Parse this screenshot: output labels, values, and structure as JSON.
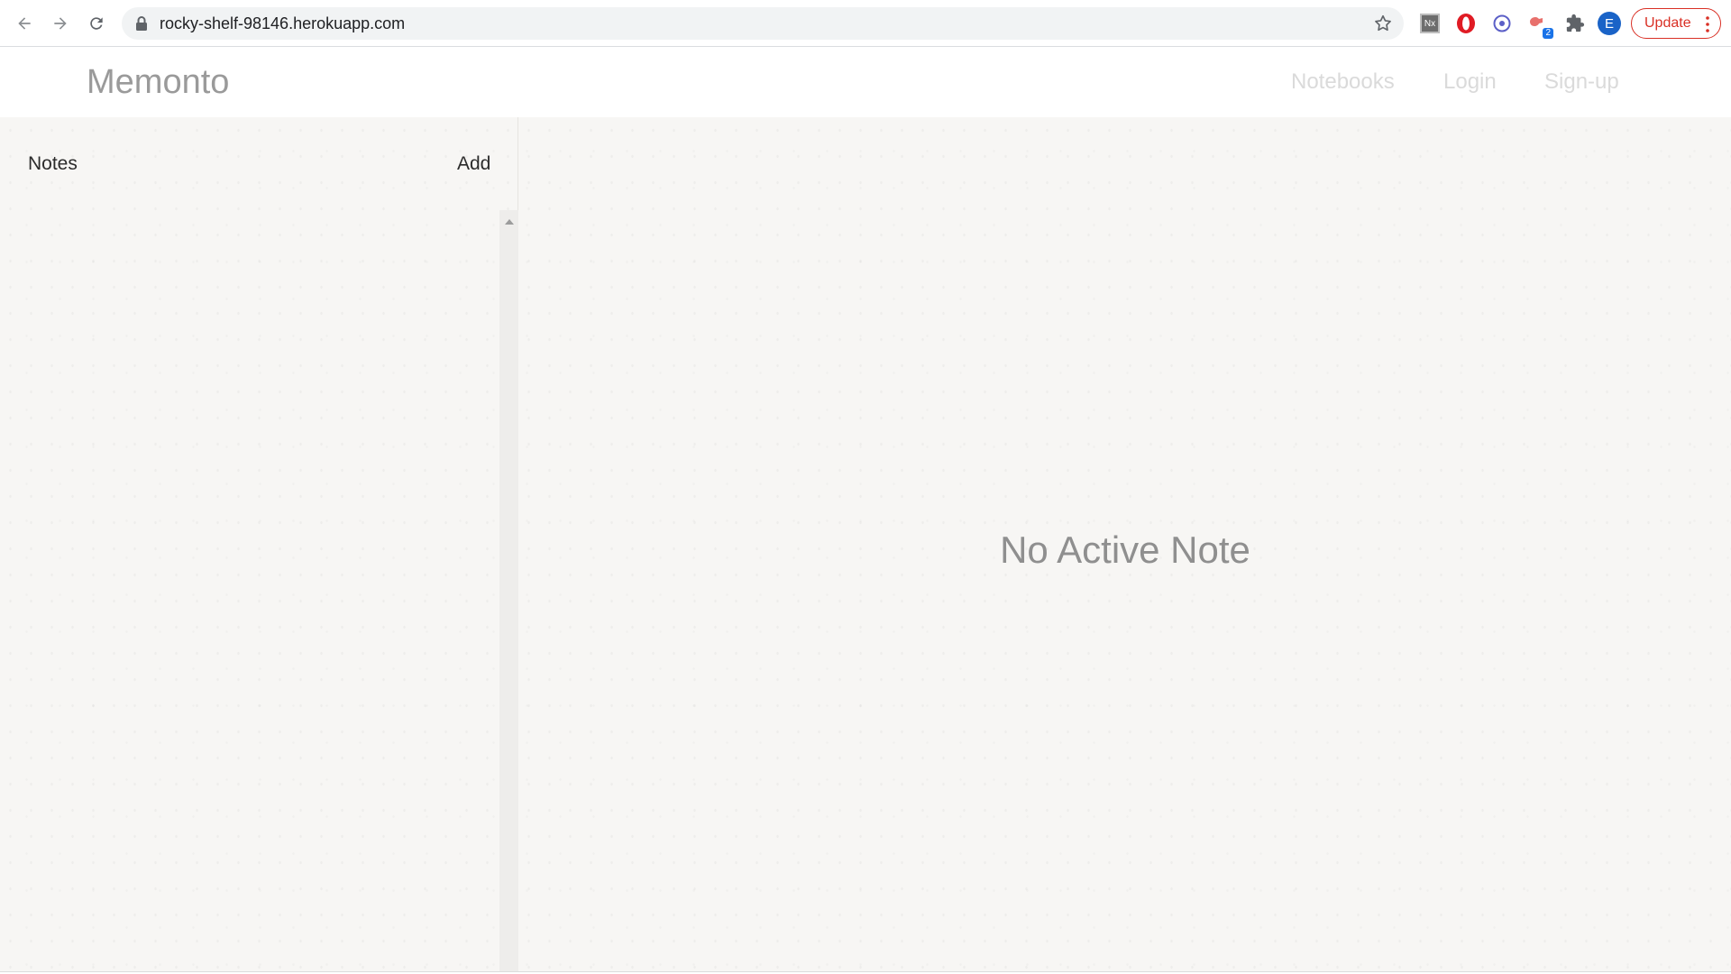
{
  "browser": {
    "url": "rocky-shelf-98146.herokuapp.com",
    "avatar_letter": "E",
    "translate_badge": "2",
    "nx_label": "Nx",
    "update_label": "Update",
    "icons": [
      "back-icon",
      "forward-icon",
      "reload-icon",
      "lock-icon",
      "star-icon",
      "nx-extension-icon",
      "opera-icon",
      "circle-extension-icon",
      "translate-extension-icon",
      "puzzle-icon",
      "kebab-menu-icon"
    ],
    "colors": {
      "update_red": "#d93025",
      "avatar_blue": "#1a63c7",
      "opera_red": "#e01b24"
    }
  },
  "header": {
    "brand": "Memonto",
    "nav": {
      "notebooks": "Notebooks",
      "login": "Login",
      "signup": "Sign-up"
    }
  },
  "sidebar": {
    "title": "Notes",
    "add_label": "Add",
    "notes": []
  },
  "main": {
    "empty_message": "No Active Note"
  }
}
